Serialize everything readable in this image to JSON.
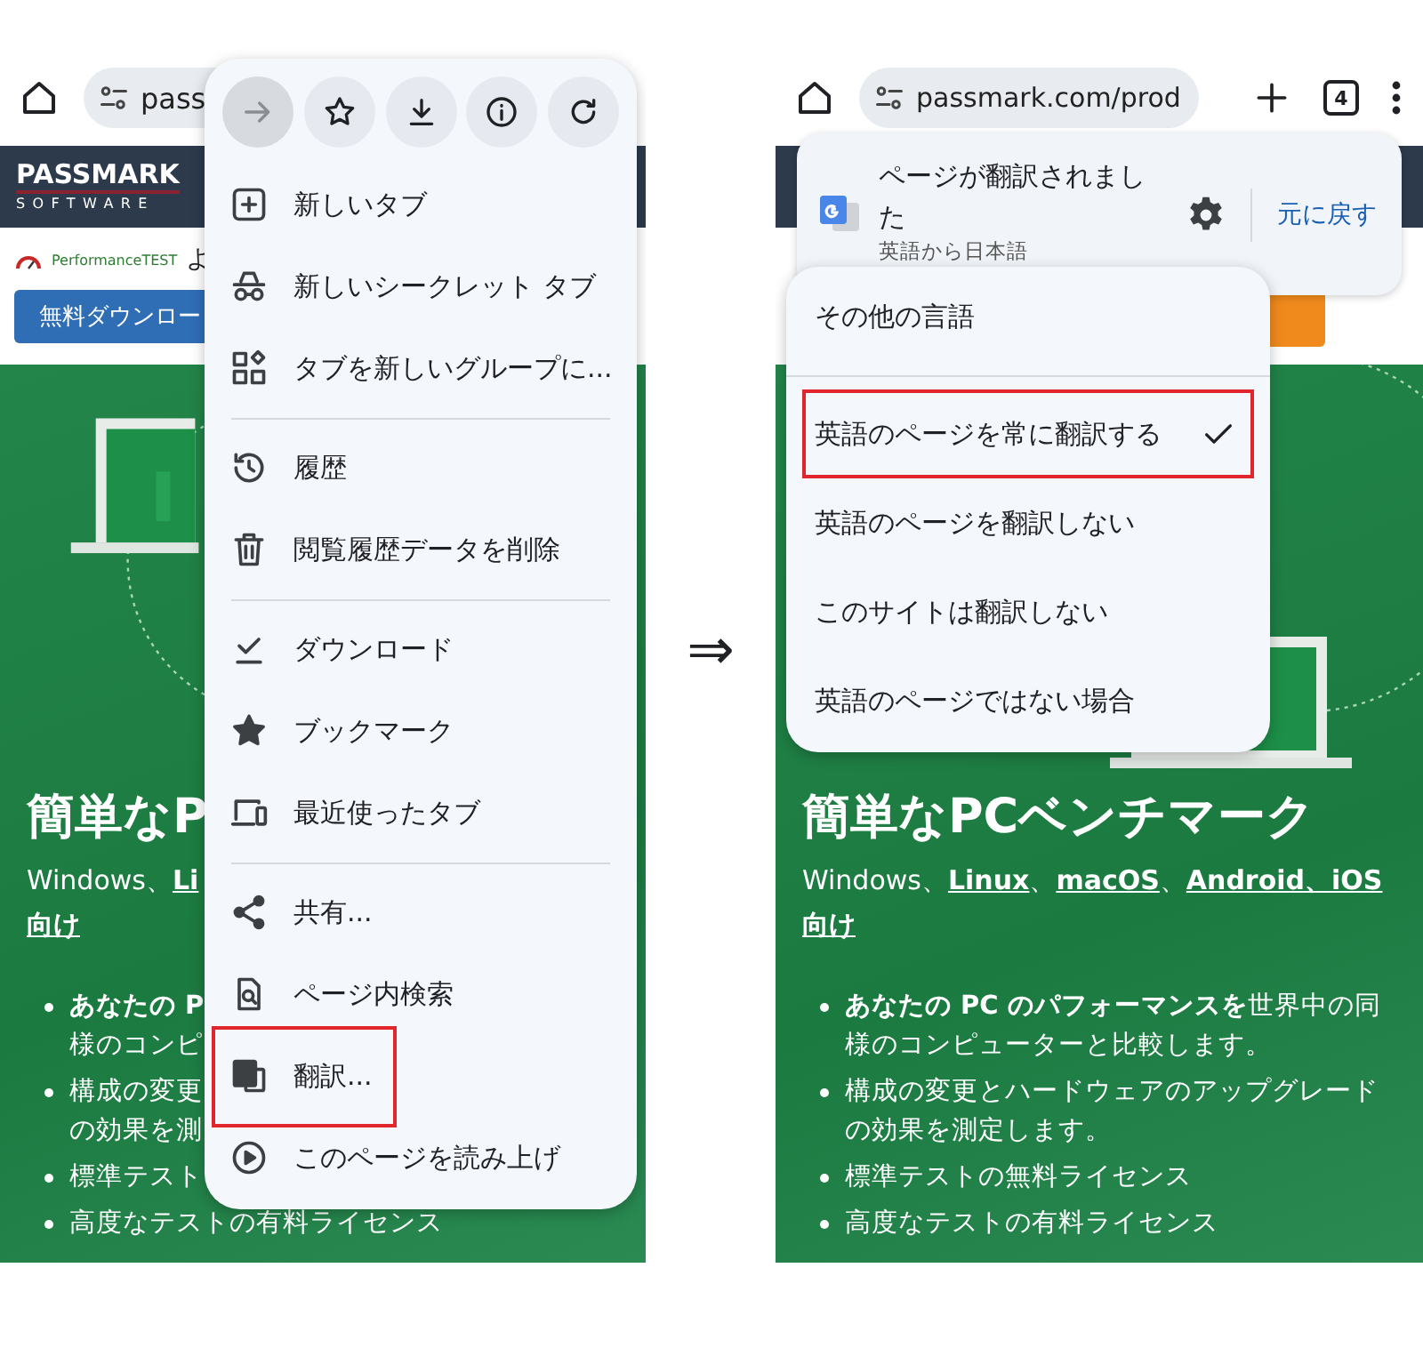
{
  "left_screen": {
    "toolbar": {
      "url": "pass"
    },
    "site_header": {
      "logo_top": "PASSMARK",
      "logo_bottom": "SOFTWARE"
    },
    "product_line": {
      "product": "PerformanceTEST",
      "text": "よ"
    },
    "download_button": "無料ダウンロー",
    "hero": {
      "title": "簡単なP",
      "subtitle_lines": [
        [
          {
            "text": "Windows、",
            "link": false
          },
          {
            "text": "Li",
            "link": true
          }
        ],
        [
          {
            "text": "向け",
            "link": true
          }
        ]
      ],
      "bullets": [
        {
          "lines": [
            {
              "text": "あなたの P",
              "bold": true
            },
            {
              "text": "様のコンピ",
              "bold": false
            }
          ]
        },
        {
          "lines": [
            {
              "text": "構成の変更",
              "bold": false
            },
            {
              "text": "の効果を測",
              "bold": false
            }
          ]
        },
        {
          "lines": [
            {
              "text": "標準テスト",
              "bold": false
            }
          ]
        },
        {
          "lines": [
            {
              "text": "高度なテストの有料ライセンス",
              "bold": false
            }
          ]
        }
      ]
    },
    "menu": {
      "actions": [
        {
          "kind": "forward",
          "disabled": true
        },
        {
          "kind": "bookmark",
          "disabled": false
        },
        {
          "kind": "download",
          "disabled": false
        },
        {
          "kind": "info",
          "disabled": false
        },
        {
          "kind": "reload",
          "disabled": false
        }
      ],
      "sections": [
        [
          {
            "kind": "new-tab",
            "label": "新しいタブ",
            "highlighted": false
          },
          {
            "kind": "incognito",
            "label": "新しいシークレット タブ",
            "highlighted": false
          },
          {
            "kind": "group",
            "label": "タブを新しいグループに...",
            "highlighted": false
          }
        ],
        [
          {
            "kind": "history",
            "label": "履歴",
            "highlighted": false
          },
          {
            "kind": "delete",
            "label": "閲覧履歴データを削除",
            "highlighted": false
          }
        ],
        [
          {
            "kind": "downloads",
            "label": "ダウンロード",
            "highlighted": false
          },
          {
            "kind": "bookmarks",
            "label": "ブックマーク",
            "highlighted": false
          },
          {
            "kind": "recent",
            "label": "最近使ったタブ",
            "highlighted": false
          }
        ],
        [
          {
            "kind": "share",
            "label": "共有...",
            "highlighted": false
          },
          {
            "kind": "find",
            "label": "ページ内検索",
            "highlighted": false
          },
          {
            "kind": "translate",
            "label": "翻訳...",
            "highlighted": true
          },
          {
            "kind": "read-aloud",
            "label": "このページを読み上げ",
            "highlighted": false
          }
        ]
      ]
    }
  },
  "arrow": "⇒",
  "right_screen": {
    "toolbar": {
      "url": "passmark.com/prod",
      "tab_count": "4"
    },
    "translate_bar": {
      "title": "ページが翻訳されました",
      "subtitle": "英語から日本語",
      "revert": "元に戻す"
    },
    "language_menu": {
      "sections": [
        [
          {
            "label": "その他の言語",
            "checked": false,
            "highlighted": false
          }
        ],
        [
          {
            "label": "英語のページを常に翻訳する",
            "checked": true,
            "highlighted": true
          },
          {
            "label": "英語のページを翻訳しない",
            "checked": false,
            "highlighted": false
          },
          {
            "label": "このサイトは翻訳しない",
            "checked": false,
            "highlighted": false
          },
          {
            "label": "英語のページではない場合",
            "checked": false,
            "highlighted": false
          }
        ]
      ]
    },
    "hero": {
      "title": "簡単なPCベンチマーク",
      "subtitle_lines": [
        [
          {
            "text": "Windows、",
            "link": false
          },
          {
            "text": "Linux",
            "link": true
          },
          {
            "text": "、",
            "link": false
          },
          {
            "text": "macOS",
            "link": true
          },
          {
            "text": "、",
            "link": false
          },
          {
            "text": "Android、iOS",
            "link": true
          }
        ],
        [
          {
            "text": "向け",
            "link": true
          }
        ]
      ],
      "bullets": [
        {
          "lines": [
            {
              "text": "**あなたの PC のパフォーマンスを**世界中の同",
              "bold": false
            },
            {
              "text": "様のコンピューターと比較します。",
              "bold": false
            }
          ]
        },
        {
          "lines": [
            {
              "text": "構成の変更とハードウェアのアップグレード",
              "bold": false
            },
            {
              "text": "の効果を測定します。",
              "bold": false
            }
          ]
        },
        {
          "lines": [
            {
              "text": "標準テストの無料ライセンス",
              "bold": false
            }
          ]
        },
        {
          "lines": [
            {
              "text": "高度なテストの有料ライセンス",
              "bold": false
            }
          ]
        }
      ]
    }
  }
}
